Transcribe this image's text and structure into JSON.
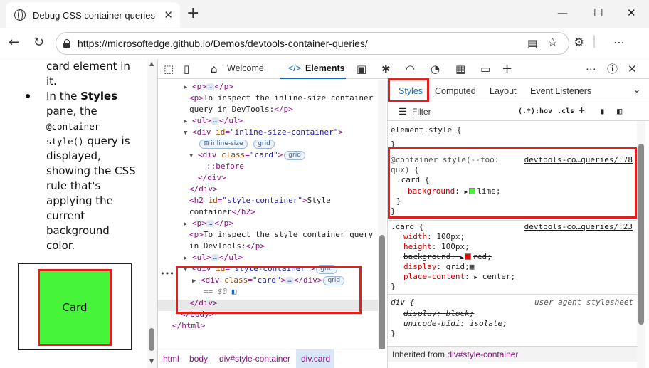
{
  "browser": {
    "tab_title": "Debug CSS container queries",
    "url": "https://microsoftedge.github.io/Demos/devtools-container-queries/",
    "icons": [
      "globe-icon",
      "close-icon",
      "plus-icon",
      "minimize-icon",
      "maximize-icon",
      "back-icon",
      "refresh-icon",
      "lock-icon",
      "reader-icon",
      "favorite-icon",
      "extensions-icon"
    ]
  },
  "page": {
    "lines": [
      "card element in",
      "it.",
      "In the ",
      "pane, the",
      "@container",
      "style()",
      " query is",
      "displayed,",
      "showing the CSS",
      "rule that's",
      "applying the",
      "current",
      "background",
      "color."
    ],
    "bold_word": "Styles",
    "card_label": "Card"
  },
  "devtools": {
    "tabs": {
      "welcome": "Welcome",
      "elements": "Elements"
    },
    "tree": {
      "p_open": "<p>",
      "p_dots": "…",
      "p_close": "</p>",
      "inline_text_1": "To inspect the inline-size container",
      "inline_text_2": "query in DevTools:",
      "ul": "<ul>",
      "ul_close": "</ul>",
      "div_inline_attr": "id",
      "div_inline_val": "\"inline-size-container\"",
      "badge_inline": "inline-size",
      "badge_grid": "grid",
      "div_card_attr": "class",
      "div_card_val": "\"card\"",
      "before": "::before",
      "div_close": "</div>",
      "h2_attr": "id",
      "h2_val": "\"style-container\"",
      "h2_text_1": "Style",
      "h2_text_2": "container",
      "h2_close": "</h2>",
      "style_text_1": "To inspect the style container query",
      "style_text_2": "in DevTools:",
      "div_style_val": "\"style-container\"",
      "eq": "== $0",
      "body_close": "</body>",
      "html_close": "</html>"
    },
    "breadcrumbs": [
      "html",
      "body",
      "div#style-container",
      "div.card"
    ],
    "styles": {
      "tabs": [
        "Styles",
        "Computed",
        "Layout",
        "Event Listeners"
      ],
      "filter_placeholder": "Filter",
      "filter_tools": [
        ":hov",
        ".cls"
      ],
      "element_style": "element.style {",
      "close_brace": "}",
      "container_query_1": "@container style(--foo:",
      "container_query_2": "qux) {",
      "container_selector": ".card {",
      "container_prop": "background",
      "container_value": "lime",
      "link_1": "devtools-co…queries/:78",
      "card_selector": ".card {",
      "link_2": "devtools-co…queries/:23",
      "props": [
        {
          "name": "width",
          "value": "100px"
        },
        {
          "name": "height",
          "value": "100px"
        },
        {
          "name": "background",
          "value": "red"
        },
        {
          "name": "display",
          "value": "grid"
        },
        {
          "name": "place-content",
          "value": "center"
        }
      ],
      "div_selector": "div {",
      "ua_label": "user agent stylesheet",
      "ua_props": [
        {
          "name": "display",
          "value": "block"
        },
        {
          "name": "unicode-bidi",
          "value": "isolate"
        }
      ],
      "inherited_label": "Inherited from ",
      "inherited_target": "div#style-container"
    }
  },
  "colors": {
    "highlight_red": "#e0201f",
    "card_green": "#46f53a",
    "accent_blue": "#0f6cbd",
    "tag_purple": "#881280"
  }
}
